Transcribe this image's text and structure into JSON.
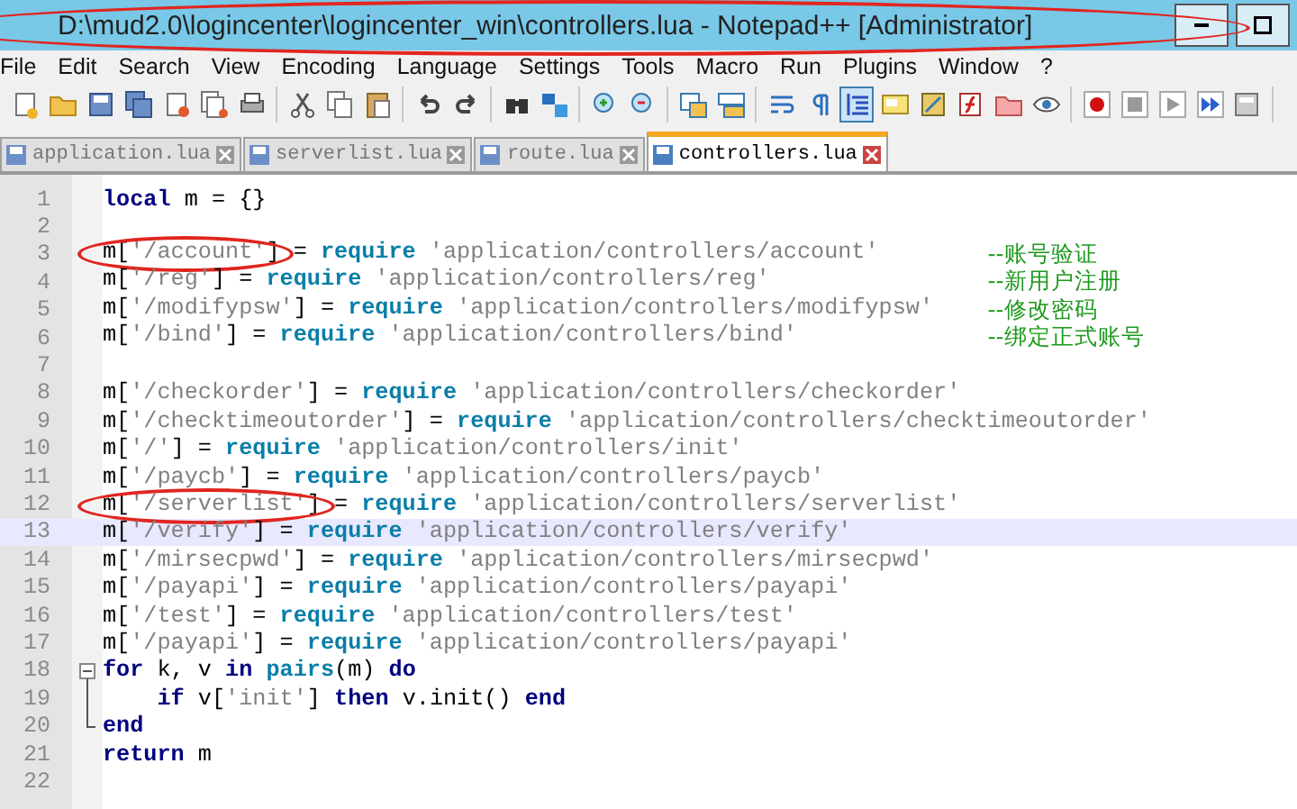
{
  "window": {
    "title": "D:\\mud2.0\\logincenter\\logincenter_win\\controllers.lua - Notepad++ [Administrator]",
    "circled": true
  },
  "menu": [
    "File",
    "Edit",
    "Search",
    "View",
    "Encoding",
    "Language",
    "Settings",
    "Tools",
    "Macro",
    "Run",
    "Plugins",
    "Window",
    "?"
  ],
  "toolbar": [
    [
      {
        "kind": "new",
        "pressed": false
      },
      {
        "kind": "open",
        "pressed": false
      },
      {
        "kind": "save",
        "pressed": false
      },
      {
        "kind": "save-all",
        "pressed": false
      },
      {
        "kind": "close",
        "pressed": false
      },
      {
        "kind": "close-all",
        "pressed": false
      },
      {
        "kind": "print",
        "pressed": false
      }
    ],
    [
      {
        "kind": "cut",
        "pressed": false
      },
      {
        "kind": "copy",
        "pressed": false
      },
      {
        "kind": "paste",
        "pressed": false
      }
    ],
    [
      {
        "kind": "undo",
        "pressed": false
      },
      {
        "kind": "redo",
        "pressed": false
      }
    ],
    [
      {
        "kind": "find",
        "pressed": false
      },
      {
        "kind": "replace",
        "pressed": false
      }
    ],
    [
      {
        "kind": "zoom-in",
        "pressed": false
      },
      {
        "kind": "zoom-out",
        "pressed": false
      }
    ],
    [
      {
        "kind": "sync-v",
        "pressed": false
      },
      {
        "kind": "sync-h",
        "pressed": false
      }
    ],
    [
      {
        "kind": "wrap",
        "pressed": false
      },
      {
        "kind": "all-chars",
        "pressed": false
      },
      {
        "kind": "indent",
        "pressed": true
      },
      {
        "kind": "udl",
        "pressed": false
      },
      {
        "kind": "doc-map",
        "pressed": false
      },
      {
        "kind": "func-list",
        "pressed": false
      },
      {
        "kind": "folder",
        "pressed": false
      },
      {
        "kind": "monitor",
        "pressed": false
      }
    ],
    [
      {
        "kind": "record",
        "pressed": false
      },
      {
        "kind": "stop",
        "pressed": false
      },
      {
        "kind": "play",
        "pressed": false
      },
      {
        "kind": "play-multi",
        "pressed": false
      },
      {
        "kind": "save-macro",
        "pressed": false
      }
    ]
  ],
  "tabs": [
    {
      "label": "application.lua",
      "selected": false
    },
    {
      "label": "serverlist.lua",
      "selected": false
    },
    {
      "label": "route.lua",
      "selected": false
    },
    {
      "label": "controllers.lua",
      "selected": true
    }
  ],
  "editor": {
    "lines": [
      {
        "kind": "code",
        "number": "1",
        "selected": false,
        "circled": false,
        "tokens": [
          {
            "kind": "keyword",
            "text": "local"
          },
          {
            "kind": "plain",
            "text": " m = {}"
          }
        ]
      },
      {
        "kind": "code",
        "number": "2",
        "selected": false,
        "circled": false
      },
      {
        "kind": "code",
        "number": "3",
        "selected": false,
        "circled": true,
        "tokens": [
          {
            "kind": "plain",
            "text": "m["
          },
          {
            "kind": "string",
            "text": "'/account'"
          },
          {
            "kind": "plain",
            "text": "] = "
          },
          {
            "kind": "function",
            "text": "require"
          },
          {
            "kind": "string",
            "text": " 'application/controllers/account'"
          }
        ],
        "comment": "--账号验证"
      },
      {
        "kind": "code",
        "number": "4",
        "selected": false,
        "circled": false,
        "tokens": [
          {
            "kind": "plain",
            "text": "m["
          },
          {
            "kind": "string",
            "text": "'/reg'"
          },
          {
            "kind": "plain",
            "text": "] = "
          },
          {
            "kind": "function",
            "text": "require"
          },
          {
            "kind": "string",
            "text": " 'application/controllers/reg'"
          }
        ],
        "comment": "--新用户注册"
      },
      {
        "kind": "code",
        "number": "5",
        "selected": false,
        "circled": false,
        "tokens": [
          {
            "kind": "plain",
            "text": "m["
          },
          {
            "kind": "string",
            "text": "'/modifypsw'"
          },
          {
            "kind": "plain",
            "text": "] = "
          },
          {
            "kind": "function",
            "text": "require"
          },
          {
            "kind": "string",
            "text": " 'application/controllers/modifypsw'"
          }
        ],
        "comment": "--修改密码"
      },
      {
        "kind": "code",
        "number": "6",
        "selected": false,
        "circled": false,
        "tokens": [
          {
            "kind": "plain",
            "text": "m["
          },
          {
            "kind": "string",
            "text": "'/bind'"
          },
          {
            "kind": "plain",
            "text": "] = "
          },
          {
            "kind": "function",
            "text": "require"
          },
          {
            "kind": "string",
            "text": " 'application/controllers/bind'"
          }
        ],
        "comment": "--绑定正式账号"
      },
      {
        "kind": "code",
        "number": "7",
        "selected": false,
        "circled": false
      },
      {
        "kind": "code",
        "number": "8",
        "selected": false,
        "circled": false,
        "tokens": [
          {
            "kind": "plain",
            "text": "m["
          },
          {
            "kind": "string",
            "text": "'/checkorder'"
          },
          {
            "kind": "plain",
            "text": "] = "
          },
          {
            "kind": "function",
            "text": "require"
          },
          {
            "kind": "string",
            "text": " 'application/controllers/checkorder'"
          }
        ]
      },
      {
        "kind": "code",
        "number": "9",
        "selected": false,
        "circled": false,
        "tokens": [
          {
            "kind": "plain",
            "text": "m["
          },
          {
            "kind": "string",
            "text": "'/checktimeoutorder'"
          },
          {
            "kind": "plain",
            "text": "] = "
          },
          {
            "kind": "function",
            "text": "require"
          },
          {
            "kind": "string",
            "text": " 'application/controllers/checktimeoutorder'"
          }
        ]
      },
      {
        "kind": "code",
        "number": "10",
        "selected": false,
        "circled": false,
        "tokens": [
          {
            "kind": "plain",
            "text": "m["
          },
          {
            "kind": "string",
            "text": "'/'"
          },
          {
            "kind": "plain",
            "text": "] = "
          },
          {
            "kind": "function",
            "text": "require"
          },
          {
            "kind": "string",
            "text": " 'application/controllers/init'"
          }
        ]
      },
      {
        "kind": "code",
        "number": "11",
        "selected": false,
        "circled": false,
        "tokens": [
          {
            "kind": "plain",
            "text": "m["
          },
          {
            "kind": "string",
            "text": "'/paycb'"
          },
          {
            "kind": "plain",
            "text": "] = "
          },
          {
            "kind": "function",
            "text": "require"
          },
          {
            "kind": "string",
            "text": " 'application/controllers/paycb'"
          }
        ]
      },
      {
        "kind": "code",
        "number": "12",
        "selected": false,
        "circled": true,
        "tokens": [
          {
            "kind": "plain",
            "text": "m["
          },
          {
            "kind": "string",
            "text": "'/serverlist'"
          },
          {
            "kind": "plain",
            "text": "] = "
          },
          {
            "kind": "function",
            "text": "require"
          },
          {
            "kind": "string",
            "text": " 'application/controllers/serverlist'"
          }
        ]
      },
      {
        "kind": "code",
        "number": "13",
        "selected": true,
        "circled": false,
        "tokens": [
          {
            "kind": "plain",
            "text": "m["
          },
          {
            "kind": "string",
            "text": "'/verify'"
          },
          {
            "kind": "plain",
            "text": "] = "
          },
          {
            "kind": "function",
            "text": "require"
          },
          {
            "kind": "string",
            "text": " 'application/controllers/verify'"
          }
        ]
      },
      {
        "kind": "code",
        "number": "14",
        "selected": false,
        "circled": false,
        "tokens": [
          {
            "kind": "plain",
            "text": "m["
          },
          {
            "kind": "string",
            "text": "'/mirsecpwd'"
          },
          {
            "kind": "plain",
            "text": "] = "
          },
          {
            "kind": "function",
            "text": "require"
          },
          {
            "kind": "string",
            "text": " 'application/controllers/mirsecpwd'"
          }
        ]
      },
      {
        "kind": "code",
        "number": "15",
        "selected": false,
        "circled": false,
        "tokens": [
          {
            "kind": "plain",
            "text": "m["
          },
          {
            "kind": "string",
            "text": "'/payapi'"
          },
          {
            "kind": "plain",
            "text": "] = "
          },
          {
            "kind": "function",
            "text": "require"
          },
          {
            "kind": "string",
            "text": " 'application/controllers/payapi'"
          }
        ]
      },
      {
        "kind": "code",
        "number": "16",
        "selected": false,
        "circled": false,
        "tokens": [
          {
            "kind": "plain",
            "text": "m["
          },
          {
            "kind": "string",
            "text": "'/test'"
          },
          {
            "kind": "plain",
            "text": "] = "
          },
          {
            "kind": "function",
            "text": "require"
          },
          {
            "kind": "string",
            "text": " 'application/controllers/test'"
          }
        ]
      },
      {
        "kind": "code",
        "number": "17",
        "selected": false,
        "circled": false,
        "tokens": [
          {
            "kind": "plain",
            "text": "m["
          },
          {
            "kind": "string",
            "text": "'/payapi'"
          },
          {
            "kind": "plain",
            "text": "] = "
          },
          {
            "kind": "function",
            "text": "require"
          },
          {
            "kind": "string",
            "text": " 'application/controllers/payapi'"
          }
        ]
      },
      {
        "number": "18",
        "selected": false,
        "circled": false,
        "kind": "foldstart",
        "tokens": [
          {
            "kind": "keyword",
            "text": "for"
          },
          {
            "kind": "plain",
            "text": " k, v "
          },
          {
            "kind": "keyword",
            "text": "in"
          },
          {
            "kind": "function",
            "text": " pairs"
          },
          {
            "kind": "plain",
            "text": "(m) "
          },
          {
            "kind": "keyword",
            "text": "do"
          }
        ]
      },
      {
        "number": "19",
        "selected": false,
        "circled": false,
        "kind": "foldbody",
        "tokens": [
          {
            "kind": "keyword",
            "text": "    if"
          },
          {
            "kind": "plain",
            "text": " v["
          },
          {
            "kind": "string",
            "text": "'init'"
          },
          {
            "kind": "plain",
            "text": "] "
          },
          {
            "kind": "keyword",
            "text": "then"
          },
          {
            "kind": "plain",
            "text": " v.init() "
          },
          {
            "kind": "keyword",
            "text": "end"
          }
        ]
      },
      {
        "number": "20",
        "selected": false,
        "circled": false,
        "kind": "foldend",
        "tokens": [
          {
            "kind": "keyword",
            "text": "end"
          }
        ]
      },
      {
        "kind": "code",
        "number": "21",
        "selected": false,
        "circled": false,
        "tokens": [
          {
            "kind": "keyword",
            "text": "return"
          },
          {
            "kind": "plain",
            "text": " m"
          }
        ]
      },
      {
        "kind": "code",
        "number": "22",
        "selected": false,
        "circled": false
      }
    ]
  }
}
